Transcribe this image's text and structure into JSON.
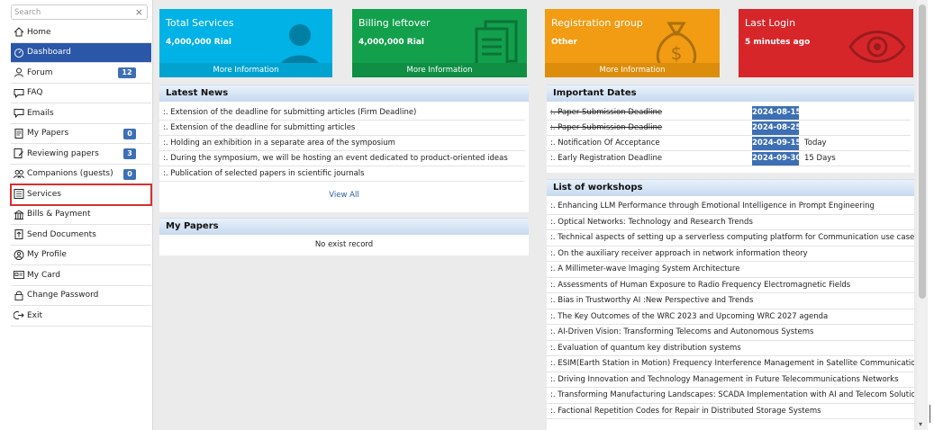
{
  "search": {
    "placeholder": "Search"
  },
  "sidebar": {
    "items": [
      {
        "label": "Home",
        "icon": "home-icon"
      },
      {
        "label": "Dashboard",
        "icon": "dashboard-icon"
      },
      {
        "label": "Forum",
        "icon": "user-icon",
        "badge": "12"
      },
      {
        "label": "FAQ",
        "icon": "chat-icon"
      },
      {
        "label": "Emails",
        "icon": "chat-icon"
      },
      {
        "label": "My Papers",
        "icon": "document-icon",
        "badge": "0"
      },
      {
        "label": "Reviewing papers",
        "icon": "review-icon",
        "badge": "3"
      },
      {
        "label": "Companions (guests)",
        "icon": "group-icon",
        "badge": "0"
      },
      {
        "label": "Services",
        "icon": "services-icon"
      },
      {
        "label": "Bills & Payment",
        "icon": "bill-icon"
      },
      {
        "label": "Send Documents",
        "icon": "send-document-icon"
      },
      {
        "label": "My Profile",
        "icon": "profile-icon"
      },
      {
        "label": "My Card",
        "icon": "card-icon"
      },
      {
        "label": "Change Password",
        "icon": "lock-icon"
      },
      {
        "label": "Exit",
        "icon": "exit-icon"
      }
    ]
  },
  "cards": {
    "services": {
      "title": "Total Services",
      "value": "4,000,000 Rial",
      "more": "More Information"
    },
    "billing": {
      "title": "Billing leftover",
      "value": "4,000,000 Rial",
      "more": "More Information"
    },
    "group": {
      "title": "Registration group",
      "value": "Other",
      "more": "More Information"
    },
    "login": {
      "title": "Last Login",
      "value": "5 minutes ago"
    }
  },
  "news": {
    "title": "Latest News",
    "items": [
      ":. Extension of the deadline for submitting articles (Firm Deadline)",
      ":. Extension of the deadline for submitting articles",
      ":. Holding an exhibition in a separate area of the symposium",
      ":. During the symposium, we will be hosting an event dedicated to product-oriented ideas",
      ":. Publication of selected papers in scientific journals"
    ],
    "view_all": "View All"
  },
  "my_papers": {
    "title": "My Papers",
    "empty": "No exist record"
  },
  "dates": {
    "title": "Important Dates",
    "items": [
      {
        "label": ":. Paper Submission Deadline",
        "date": "2024-08-15",
        "note": ""
      },
      {
        "label": ":. Paper Submission Deadline",
        "date": "2024-08-25",
        "note": ""
      },
      {
        "label": ":. Notification Of Acceptance",
        "date": "2024-09-15",
        "note": "Today"
      },
      {
        "label": ":. Early Registration Deadline",
        "date": "2024-09-30",
        "note": "15 Days"
      }
    ]
  },
  "workshops": {
    "title": "List of workshops",
    "items": [
      ":. Enhancing LLM Performance through Emotional Intelligence in Prompt Engineering",
      ":. Optical Networks: Technology and Research Trends",
      ":. Technical aspects of setting up a serverless computing platform for Communication use cases",
      ":. On the auxiliary receiver approach in network information theory",
      ":. A Millimeter-wave Imaging System Architecture",
      ":. Assessments of Human Exposure to Radio Frequency Electromagnetic Fields",
      ":. Bias in Trustworthy AI :New Perspective and Trends",
      ":. The Key Outcomes of the WRC 2023 and Upcoming WRC 2027 agenda",
      ":. AI-Driven Vision: Transforming Telecoms and Autonomous Systems",
      ":. Evaluation of quantum key distribution systems",
      ":. ESIM(Earth Station in Motion) Frequency Interference Management in Satellite Communication",
      ":. Driving Innovation and Technology Management in Future Telecommunications Networks",
      ":. Transforming Manufacturing Landscapes: SCADA Implementation with AI and Telecom Solutions",
      ":. Factional Repetition Codes for Repair in Distributed Storage Systems"
    ]
  },
  "colors": {
    "services_card": "#00b2e5",
    "billing_card": "#12a04d",
    "group_card": "#f19c12",
    "login_card": "#d7262a",
    "active_nav": "#2b57a8",
    "badge": "#3d6fb4",
    "highlight_outline": "#d62f2f"
  }
}
